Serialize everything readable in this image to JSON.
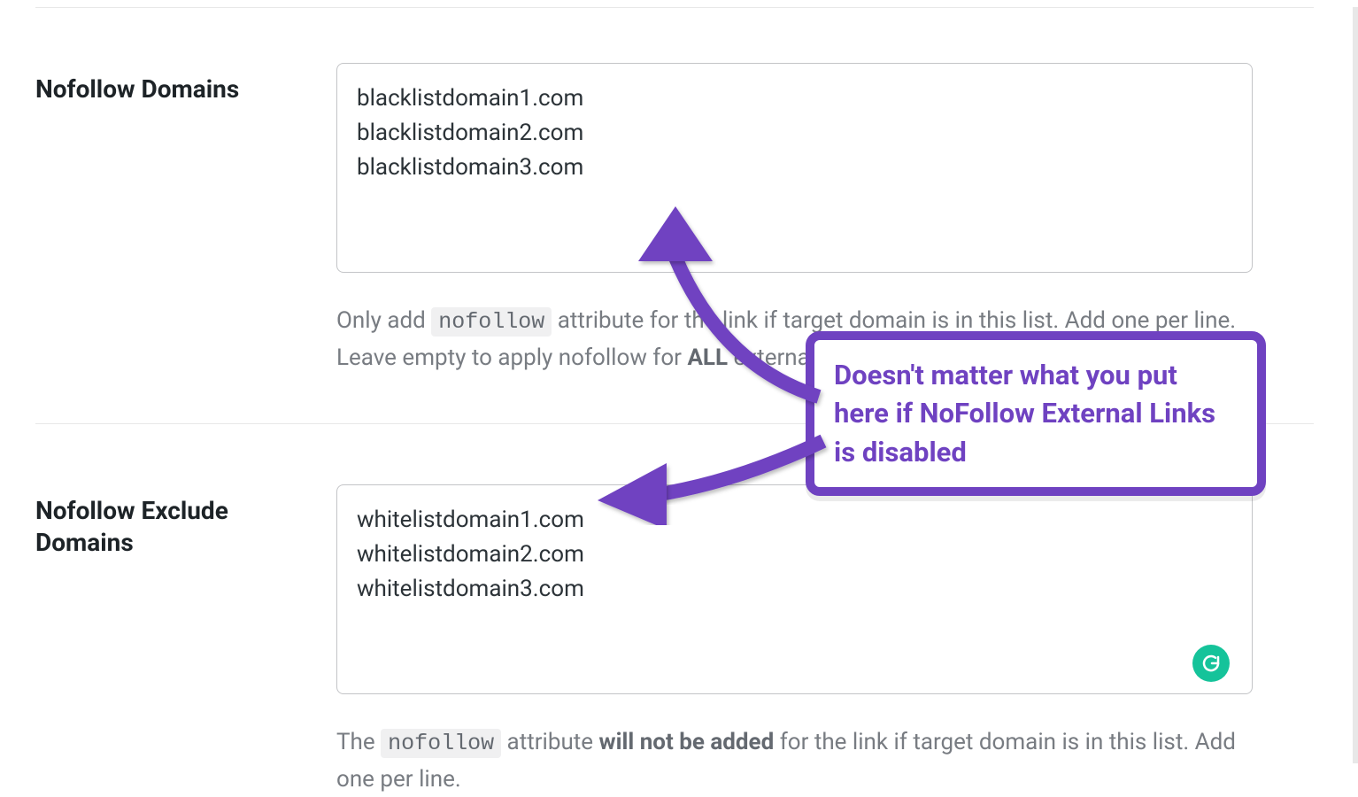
{
  "sections": {
    "nofollow_domains": {
      "label": "Nofollow Domains",
      "textarea_value": "blacklistdomain1.com\nblacklistdomain2.com\nblacklistdomain3.com",
      "help_pre": "Only add ",
      "help_code": "nofollow",
      "help_mid": " attribute for the link if target domain is in this list. Add one per line. Leave empty to apply nofollow for ",
      "help_bold": "ALL",
      "help_post": " external domains."
    },
    "nofollow_exclude": {
      "label": "Nofollow Exclude Domains",
      "textarea_value": "whitelistdomain1.com\nwhitelistdomain2.com\nwhitelistdomain3.com",
      "help_pre": "The ",
      "help_code": "nofollow",
      "help_mid": " attribute ",
      "help_bold": "will not be added",
      "help_post": " for the link if target domain is in this list. Add one per line."
    }
  },
  "annotation": {
    "text": "Doesn't matter what you put here if NoFollow External Links is disabled"
  },
  "colors": {
    "accent_purple": "#6f42c1",
    "grammarly_green": "#15c39a"
  }
}
